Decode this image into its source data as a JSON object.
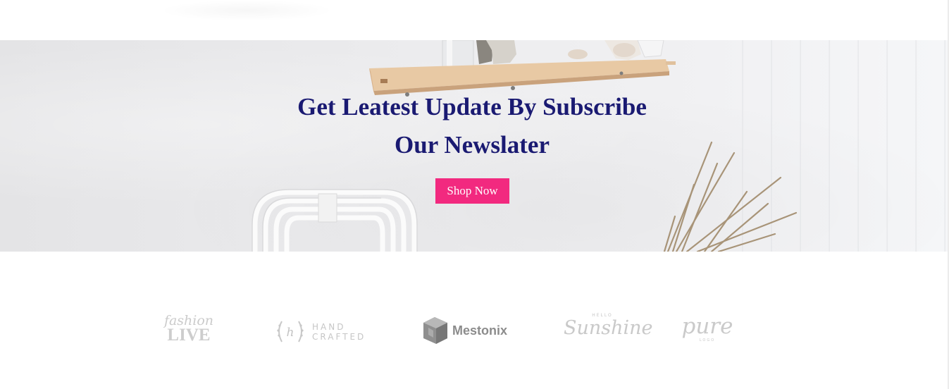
{
  "newsletter": {
    "headline_line1": "Get Leatest Update By Subscribe",
    "headline_line2": "Our Newslater",
    "button_label": "Shop Now",
    "headline_color": "#1a1a72",
    "button_color": "#f2297f"
  },
  "brands": {
    "fashion_live": {
      "script": "fashion",
      "block": "LIVE",
      "icon": "fashion-live-logo"
    },
    "hand_crafted": {
      "line1": "HAND",
      "line2": "CRAFTED",
      "badge_letter": "h",
      "icon": "hand-crafted-logo"
    },
    "mestonix": {
      "name": "Mestonix",
      "icon": "cube-icon"
    },
    "sunshine": {
      "small": "HELLO",
      "script": "Sunshine",
      "icon": "sunshine-logo"
    },
    "pure": {
      "script": "pure",
      "small": "LOGO",
      "icon": "pure-logo"
    }
  }
}
